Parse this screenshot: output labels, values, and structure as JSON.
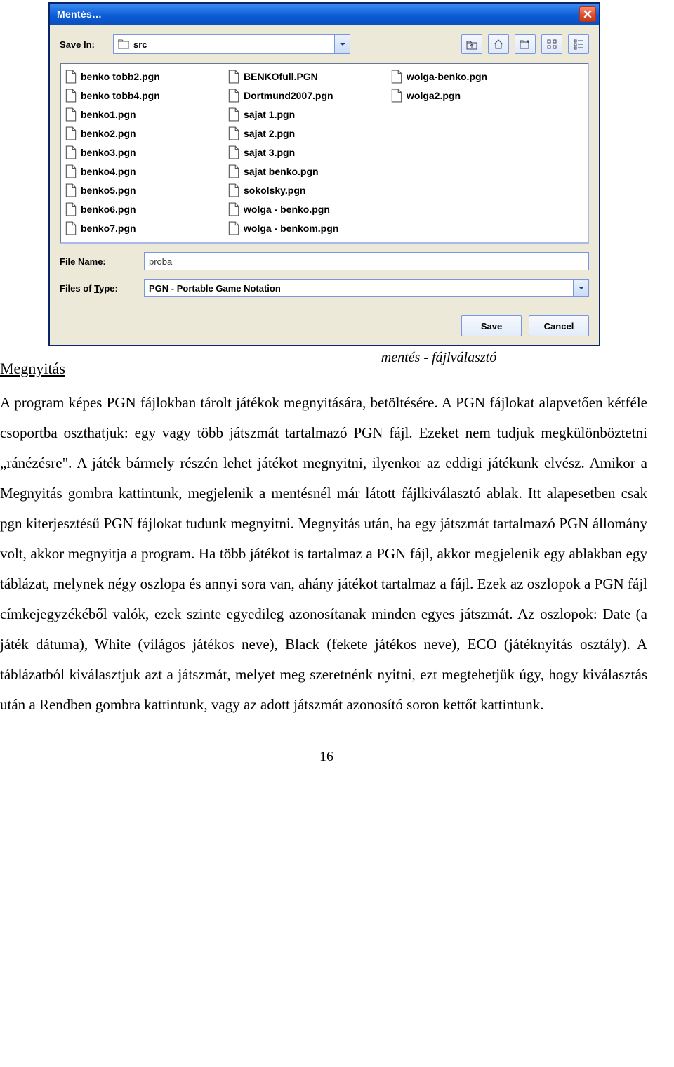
{
  "dialog": {
    "title": "Mentés…",
    "save_in_label": "Save In:",
    "save_in_value": "src",
    "file_name_label_pre": "File ",
    "file_name_label_u": "N",
    "file_name_label_post": "ame:",
    "file_name_value": "proba",
    "files_type_label_pre": "Files of ",
    "files_type_label_u": "T",
    "files_type_label_post": "ype:",
    "files_type_value": "PGN - Portable Game Notation",
    "save_btn": "Save",
    "cancel_btn": "Cancel",
    "files": [
      "benko tobb2.pgn",
      "benko tobb4.pgn",
      "benko1.pgn",
      "benko2.pgn",
      "benko3.pgn",
      "benko4.pgn",
      "benko5.pgn",
      "benko6.pgn",
      "benko7.pgn",
      "BENKOfull.PGN",
      "Dortmund2007.pgn",
      "sajat 1.pgn",
      "sajat 2.pgn",
      "sajat 3.pgn",
      "sajat benko.pgn",
      "sokolsky.pgn",
      "wolga - benko.pgn",
      "wolga - benkom.pgn",
      "wolga-benko.pgn",
      "wolga2.pgn"
    ]
  },
  "doc": {
    "caption": "mentés - fájlválasztó",
    "heading": "Megnyitás",
    "paragraph": "A program képes PGN fájlokban tárolt játékok megnyitására, betöltésére. A PGN fájlokat alapvetően kétféle csoportba oszthatjuk: egy vagy több játszmát tartalmazó PGN fájl. Ezeket nem tudjuk megkülönböztetni „ránézésre\". A játék bármely részén lehet játékot megnyitni, ilyenkor az eddigi játékunk elvész. Amikor a Megnyitás gombra kattintunk, megjelenik a mentésnél már látott fájlkiválasztó ablak. Itt alapesetben csak pgn kiterjesztésű PGN fájlokat tudunk megnyitni. Megnyitás után, ha egy játszmát tartalmazó PGN állomány volt, akkor megnyitja a program. Ha több játékot is tartalmaz a PGN fájl, akkor megjelenik egy ablakban egy táblázat, melynek négy oszlopa és annyi sora van, ahány játékot tartalmaz a fájl. Ezek az oszlopok a PGN fájl címkejegyzékéből valók, ezek szinte egyedileg azonosítanak minden egyes játszmát. Az oszlopok: Date (a játék dátuma), White (világos játékos neve), Black (fekete játékos neve), ECO (játéknyitás osztály). A táblázatból kiválasztjuk azt a játszmát, melyet meg szeretnénk nyitni, ezt megtehetjük úgy, hogy kiválasztás után a Rendben gombra kattintunk, vagy az adott játszmát azonosító soron kettőt kattintunk.",
    "page_number": "16"
  }
}
